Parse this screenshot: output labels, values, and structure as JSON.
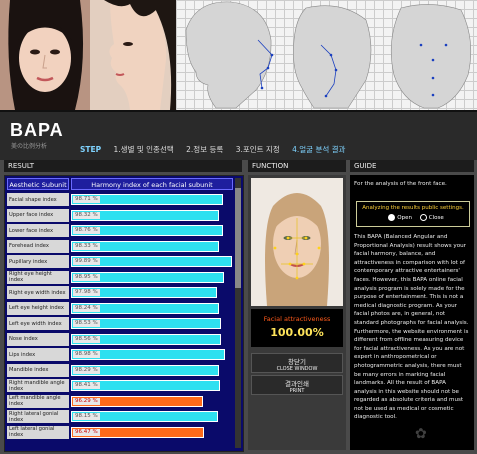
{
  "header": {
    "logo": "BAPA",
    "logo_sub": "美の比例分析",
    "step_label": "STEP",
    "steps": [
      "1.생별 및 인종선택",
      "2.정보 등록",
      "3.포인트 지정",
      "4.얼굴 분석 결과"
    ]
  },
  "sections": {
    "result": "RESULT",
    "function": "FUNCTION",
    "guide": "GUIDE"
  },
  "result": {
    "col_a": "Aesthetic Subunit",
    "col_b": "Harmony index of each facial subunit",
    "rows": [
      {
        "label": "Facial shape index",
        "value": "98.71 %",
        "level": 0.9871,
        "warn": false
      },
      {
        "label": "Upper face index",
        "value": "98.32 %",
        "level": 0.9832,
        "warn": false
      },
      {
        "label": "Lower face index",
        "value": "98.76 %",
        "level": 0.9876,
        "warn": false
      },
      {
        "label": "Forehead index",
        "value": "98.33 %",
        "level": 0.9833,
        "warn": false
      },
      {
        "label": "Pupillary index",
        "value": "99.89 %",
        "level": 0.9989,
        "warn": false
      },
      {
        "label": "Right eye height index",
        "value": "98.95 %",
        "level": 0.9895,
        "warn": false
      },
      {
        "label": "Right eye width index",
        "value": "97.98 %",
        "level": 0.9798,
        "warn": false
      },
      {
        "label": "Left eye height index",
        "value": "98.24 %",
        "level": 0.9824,
        "warn": false
      },
      {
        "label": "Left eye width index",
        "value": "98.53 %",
        "level": 0.9853,
        "warn": false
      },
      {
        "label": "Nose index",
        "value": "98.56 %",
        "level": 0.9856,
        "warn": false
      },
      {
        "label": "Lips index",
        "value": "98.98 %",
        "level": 0.9898,
        "warn": false
      },
      {
        "label": "Mandible index",
        "value": "98.29 %",
        "level": 0.9829,
        "warn": false
      },
      {
        "label": "Right mandible angle index",
        "value": "98.41 %",
        "level": 0.9841,
        "warn": false
      },
      {
        "label": "Left mandible angle index",
        "value": "96.29 %",
        "level": 0.9629,
        "warn": true
      },
      {
        "label": "Right lateral gonial index",
        "value": "98.15 %",
        "level": 0.9815,
        "warn": false
      },
      {
        "label": "Left lateral gonial index",
        "value": "96.47 %",
        "level": 0.9647,
        "warn": true
      }
    ]
  },
  "function": {
    "attr_label": "Facial attractiveness",
    "attr_value": "100.00%",
    "close_k": "창닫기",
    "close_e": "CLOSE WINDOW",
    "print_k": "결과인쇄",
    "print_e": "PRINT"
  },
  "guide": {
    "intro": "For the analysis of the front face.",
    "box_title": "Analyzing the results public settings.",
    "open": "Open",
    "close": "Close",
    "body": "This BAPA (Balanced Angular and Proportional Analysis) result shows your facial harmony, balance, and attractiveness in comparison with lot of contemporary attractive entertainers' faces. However, this BAPA online facial analysis program is solely made for the purpose of entertainment. This is not a medical diagnostic program. As your facial photos are, in general, not standard photographs for facial analysis. Furthermore, the website environment is different from offline measuring device for facial attractiveness. As you are not expert in anthropometrical or photogrammetric analysis, there must be many errors in marking facial landmarks. All the result of BAPA analysis in this website should not be regarded as absolute criteria and must not be used as medical or cosmetic diagnostic tool."
  },
  "colors": {
    "bar": "#2ee0f0",
    "bar_warn": "#ff6a1a",
    "accent": "#7fd3ff"
  }
}
